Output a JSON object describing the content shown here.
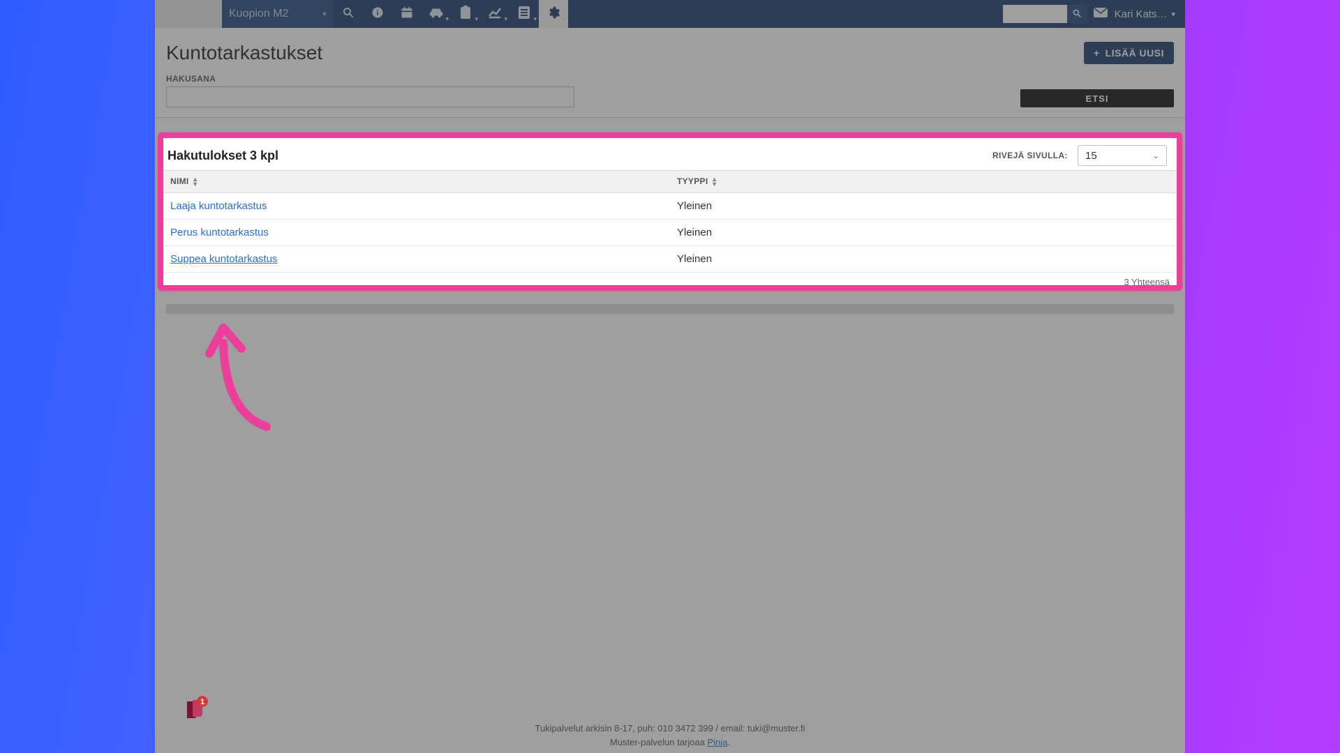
{
  "nav": {
    "org_selected": "Kuopion M2",
    "user_name": "Kari Kats…"
  },
  "page": {
    "title": "Kuntotarkastukset",
    "add_button": "LISÄÄ UUSI",
    "search_label": "HAKUSANA",
    "search_button": "ETSI"
  },
  "results": {
    "title": "Hakutulokset 3 kpl",
    "rows_per_page_label": "RIVEJÄ SIVULLA:",
    "rows_per_page_value": "15",
    "columns": {
      "name": "NIMI",
      "type": "TYYPPI"
    },
    "rows": [
      {
        "name": "Laaja kuntotarkastus",
        "type": "Yleinen"
      },
      {
        "name": "Perus kuntotarkastus",
        "type": "Yleinen"
      },
      {
        "name": "Suppea kuntotarkastus",
        "type": "Yleinen"
      }
    ],
    "footer_total": "3 Yhteensä"
  },
  "footer": {
    "line1": "Tukipalvelut arkisin 8-17, puh: 010 3472 399 / email: tuki@muster.fi",
    "line2_prefix": "Muster-palvelun tarjoaa ",
    "line2_link": "Pinja",
    "line2_suffix": "."
  },
  "icons": {
    "search": "search-icon",
    "info": "info-icon",
    "calendar": "calendar-icon",
    "car": "car-icon",
    "clipboard": "clipboard-icon",
    "chart": "chart-icon",
    "list": "list-icon",
    "gear": "gear-icon",
    "mail": "mail-icon",
    "plus": "plus-icon",
    "chevron_down": "chevron-down-icon"
  },
  "colors": {
    "navbar": "#1a3a6b",
    "highlight_border": "#ec3e9b",
    "link": "#2a6fcf"
  }
}
